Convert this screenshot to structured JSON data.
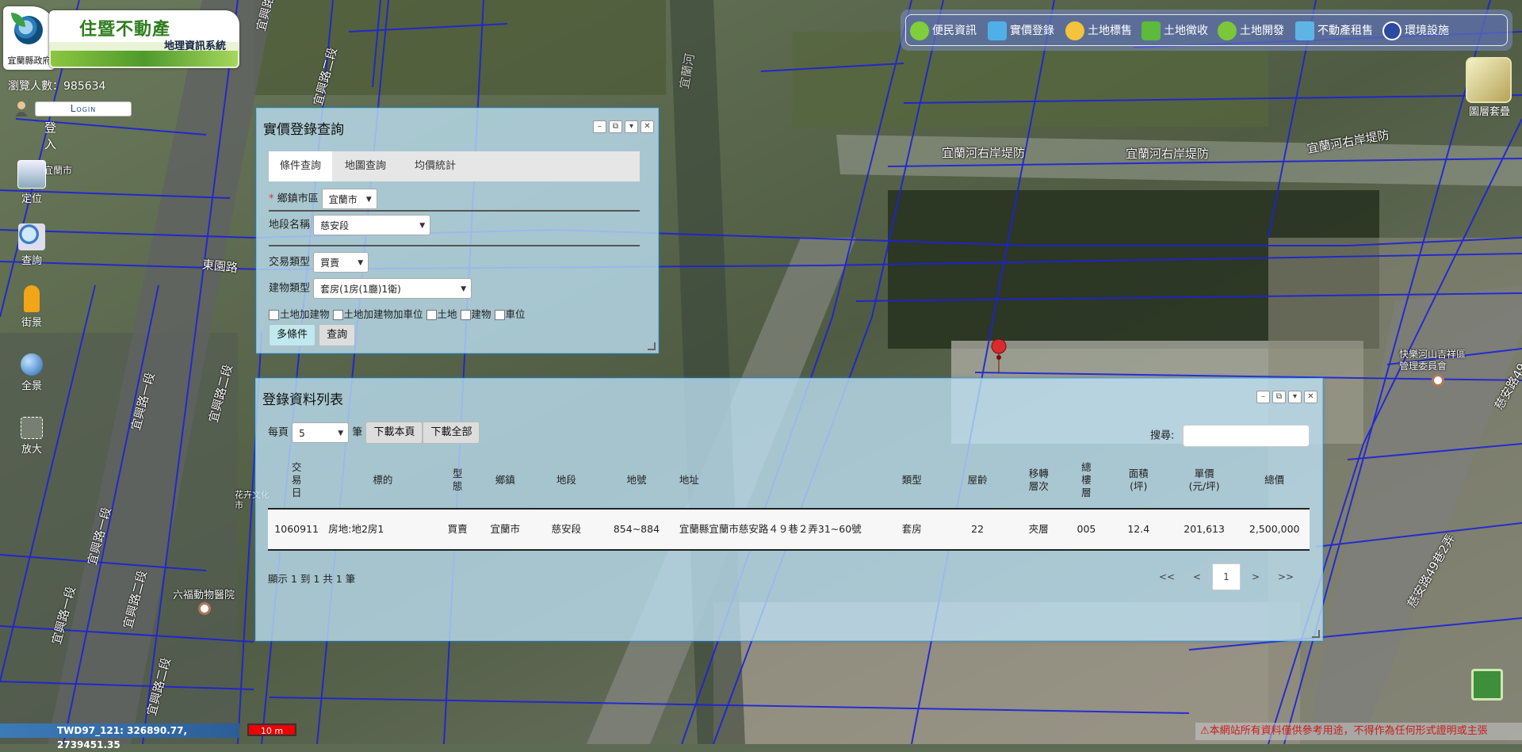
{
  "logo": {
    "county": "宜蘭縣政府",
    "title": "住暨不動產",
    "subtitle": "地理資訊系統"
  },
  "visits": {
    "label": "瀏覽人數：",
    "count": "985634"
  },
  "login": {
    "button": "Login",
    "label": "登入"
  },
  "left_nav": [
    {
      "label": "定位",
      "icon": "locate-icon"
    },
    {
      "label": "查詢",
      "icon": "magnifier-icon"
    },
    {
      "label": "街景",
      "icon": "pegman-icon"
    },
    {
      "label": "全景",
      "icon": "globe-icon"
    },
    {
      "label": "放大",
      "icon": "zoom-icon"
    }
  ],
  "top_tools": [
    {
      "label": "便民資訊",
      "icon": "leaf-icon",
      "color": "#7fcf3a"
    },
    {
      "label": "實價登錄",
      "icon": "price-tag-icon",
      "color": "#4fb0e8"
    },
    {
      "label": "土地標售",
      "icon": "money-bag-icon",
      "color": "#f2c33b"
    },
    {
      "label": "土地徵收",
      "icon": "collect-icon",
      "color": "#5cba3c"
    },
    {
      "label": "土地開發",
      "icon": "sprout-icon",
      "color": "#7cc63a"
    },
    {
      "label": "不動產租售",
      "icon": "house-icon",
      "color": "#5fb4e6"
    },
    {
      "label": "環境設施",
      "icon": "info-icon",
      "color": "#2b4aa0"
    }
  ],
  "layers": {
    "label": "圖層套疊"
  },
  "map_labels": {
    "streets": [
      "宜興路一段",
      "宜興路二段",
      "東園路",
      "宜蘭河右岸堤防",
      "宜蘭河右岸堤防",
      "宜蘭河右岸堤防",
      "宜興路一段",
      "宜興路二段",
      "宜興路一段",
      "宜興路二段",
      "宜興路一段",
      "宜興路二段",
      "慈安路49巷2弄",
      "慈安路49",
      "宜蘭河",
      "宜蘭市"
    ],
    "poi_flower": "花卉文化市",
    "poi_vet": "六福動物醫院",
    "poi_community": "快樂河山吉祥區管理委員會"
  },
  "query_panel": {
    "title": "實價登錄查詢",
    "tabs": [
      "條件查詢",
      "地圖查詢",
      "均價統計"
    ],
    "district_label": "鄉鎮市區",
    "district_value": "宜蘭市",
    "section_label": "地段名稱",
    "section_value": "慈安段",
    "trade_label": "交易類型",
    "trade_value": "買賣",
    "building_label": "建物類型",
    "building_value": "套房(1房(1廳)1衛)",
    "checkboxes": [
      "土地加建物",
      "土地加建物加車位",
      "土地",
      "建物",
      "車位"
    ],
    "btn_multi": "多條件",
    "btn_query": "查詢"
  },
  "list_panel": {
    "title": "登錄資料列表",
    "per_page_label": "每頁",
    "per_page_value": "5",
    "per_page_unit": "筆",
    "btn_download_page": "下載本頁",
    "btn_download_all": "下載全部",
    "search_label": "搜尋:",
    "columns": [
      "交易日",
      "標的",
      "型態",
      "鄉鎮",
      "地段",
      "地號",
      "地址",
      "類型",
      "屋齡",
      "移轉層次",
      "總樓層",
      "面積(坪)",
      "單價(元/坪)",
      "總價"
    ],
    "rows": [
      [
        "1060911",
        "房地:地2房1",
        "買賣",
        "宜蘭市",
        "慈安段",
        "854~884",
        "宜蘭縣宜蘭市慈安路４９巷２弄31~60號",
        "套房",
        "22",
        "夾層",
        "005",
        "12.4",
        "201,613",
        "2,500,000"
      ]
    ],
    "info": "顯示 1 到 1 共 1 筆",
    "pager": [
      "<<",
      "<",
      "1",
      ">",
      ">>"
    ]
  },
  "status": {
    "coords": "TWD97_121: 326890.77, 2739451.35",
    "scale": "10 m",
    "disclaimer": "⚠本網站所有資料僅供參考用途，不得作為任何形式證明或主張"
  }
}
